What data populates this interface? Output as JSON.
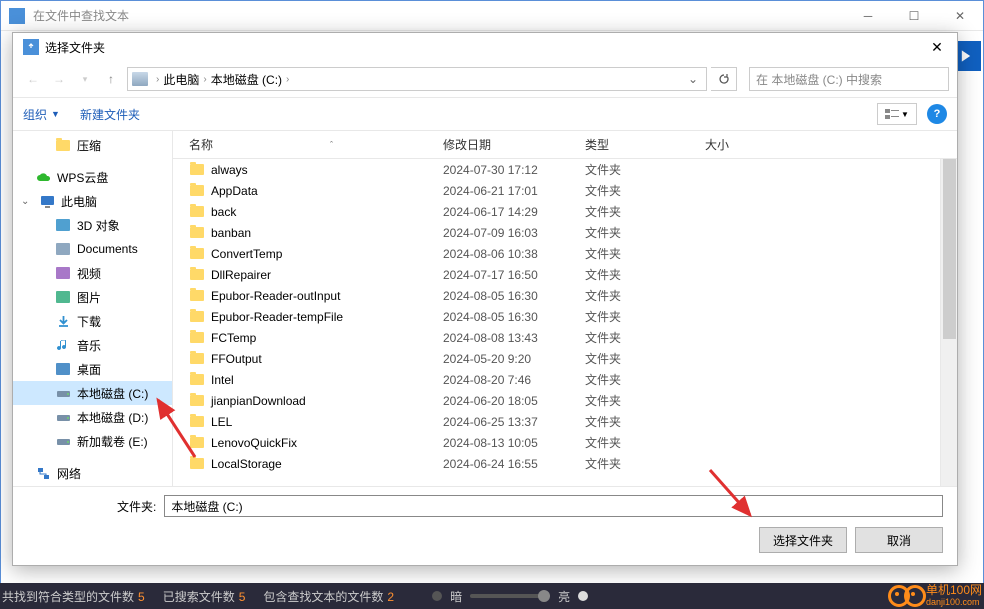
{
  "parentWindow": {
    "title": "在文件中查找文本"
  },
  "dialog": {
    "title": "选择文件夹",
    "breadcrumb": {
      "pc": "此电脑",
      "drive": "本地磁盘 (C:)"
    },
    "searchPlaceholder": "在 本地磁盘 (C:) 中搜索",
    "toolbar": {
      "organize": "组织",
      "newFolder": "新建文件夹"
    },
    "columns": {
      "name": "名称",
      "date": "修改日期",
      "type": "类型",
      "size": "大小"
    },
    "tree": [
      {
        "label": "压缩",
        "icon": "folder",
        "indent": "sub"
      },
      {
        "label": "WPS云盘",
        "icon": "cloud",
        "indent": "root",
        "spacer": true
      },
      {
        "label": "此电脑",
        "icon": "pc",
        "indent": "root",
        "expand": "open"
      },
      {
        "label": "3D 对象",
        "icon": "3d",
        "indent": "sub"
      },
      {
        "label": "Documents",
        "icon": "doc",
        "indent": "sub"
      },
      {
        "label": "视频",
        "icon": "video",
        "indent": "sub"
      },
      {
        "label": "图片",
        "icon": "pic",
        "indent": "sub"
      },
      {
        "label": "下载",
        "icon": "download",
        "indent": "sub"
      },
      {
        "label": "音乐",
        "icon": "music",
        "indent": "sub"
      },
      {
        "label": "桌面",
        "icon": "desktop",
        "indent": "sub"
      },
      {
        "label": "本地磁盘 (C:)",
        "icon": "drive",
        "indent": "sub",
        "selected": true
      },
      {
        "label": "本地磁盘 (D:)",
        "icon": "drive",
        "indent": "sub"
      },
      {
        "label": "新加载卷 (E:)",
        "icon": "drive",
        "indent": "sub"
      },
      {
        "label": "网络",
        "icon": "network",
        "indent": "root",
        "spacer": true
      }
    ],
    "files": [
      {
        "name": "always",
        "date": "2024-07-30 17:12",
        "type": "文件夹"
      },
      {
        "name": "AppData",
        "date": "2024-06-21 17:01",
        "type": "文件夹"
      },
      {
        "name": "back",
        "date": "2024-06-17 14:29",
        "type": "文件夹"
      },
      {
        "name": "banban",
        "date": "2024-07-09 16:03",
        "type": "文件夹"
      },
      {
        "name": "ConvertTemp",
        "date": "2024-08-06 10:38",
        "type": "文件夹"
      },
      {
        "name": "DllRepairer",
        "date": "2024-07-17 16:50",
        "type": "文件夹"
      },
      {
        "name": "Epubor-Reader-outInput",
        "date": "2024-08-05 16:30",
        "type": "文件夹"
      },
      {
        "name": "Epubor-Reader-tempFile",
        "date": "2024-08-05 16:30",
        "type": "文件夹"
      },
      {
        "name": "FCTemp",
        "date": "2024-08-08 13:43",
        "type": "文件夹"
      },
      {
        "name": "FFOutput",
        "date": "2024-05-20 9:20",
        "type": "文件夹"
      },
      {
        "name": "Intel",
        "date": "2024-08-20 7:46",
        "type": "文件夹"
      },
      {
        "name": "jianpianDownload",
        "date": "2024-06-20 18:05",
        "type": "文件夹"
      },
      {
        "name": "LEL",
        "date": "2024-06-25 13:37",
        "type": "文件夹"
      },
      {
        "name": "LenovoQuickFix",
        "date": "2024-08-13 10:05",
        "type": "文件夹"
      },
      {
        "name": "LocalStorage",
        "date": "2024-06-24 16:55",
        "type": "文件夹"
      }
    ],
    "footer": {
      "folderLabel": "文件夹:",
      "folderValue": "本地磁盘 (C:)",
      "selectBtn": "选择文件夹",
      "cancelBtn": "取消"
    }
  },
  "statusbar": {
    "seg1": {
      "label": "共找到符合类型的文件数",
      "value": "5"
    },
    "seg2": {
      "label": "已搜索文件数",
      "value": "5"
    },
    "seg3": {
      "label": "包含查找文本的文件数",
      "value": "2"
    },
    "dark": "暗",
    "light": "亮",
    "logoTop": "单机100网",
    "logoBottom": "danji100.com"
  }
}
